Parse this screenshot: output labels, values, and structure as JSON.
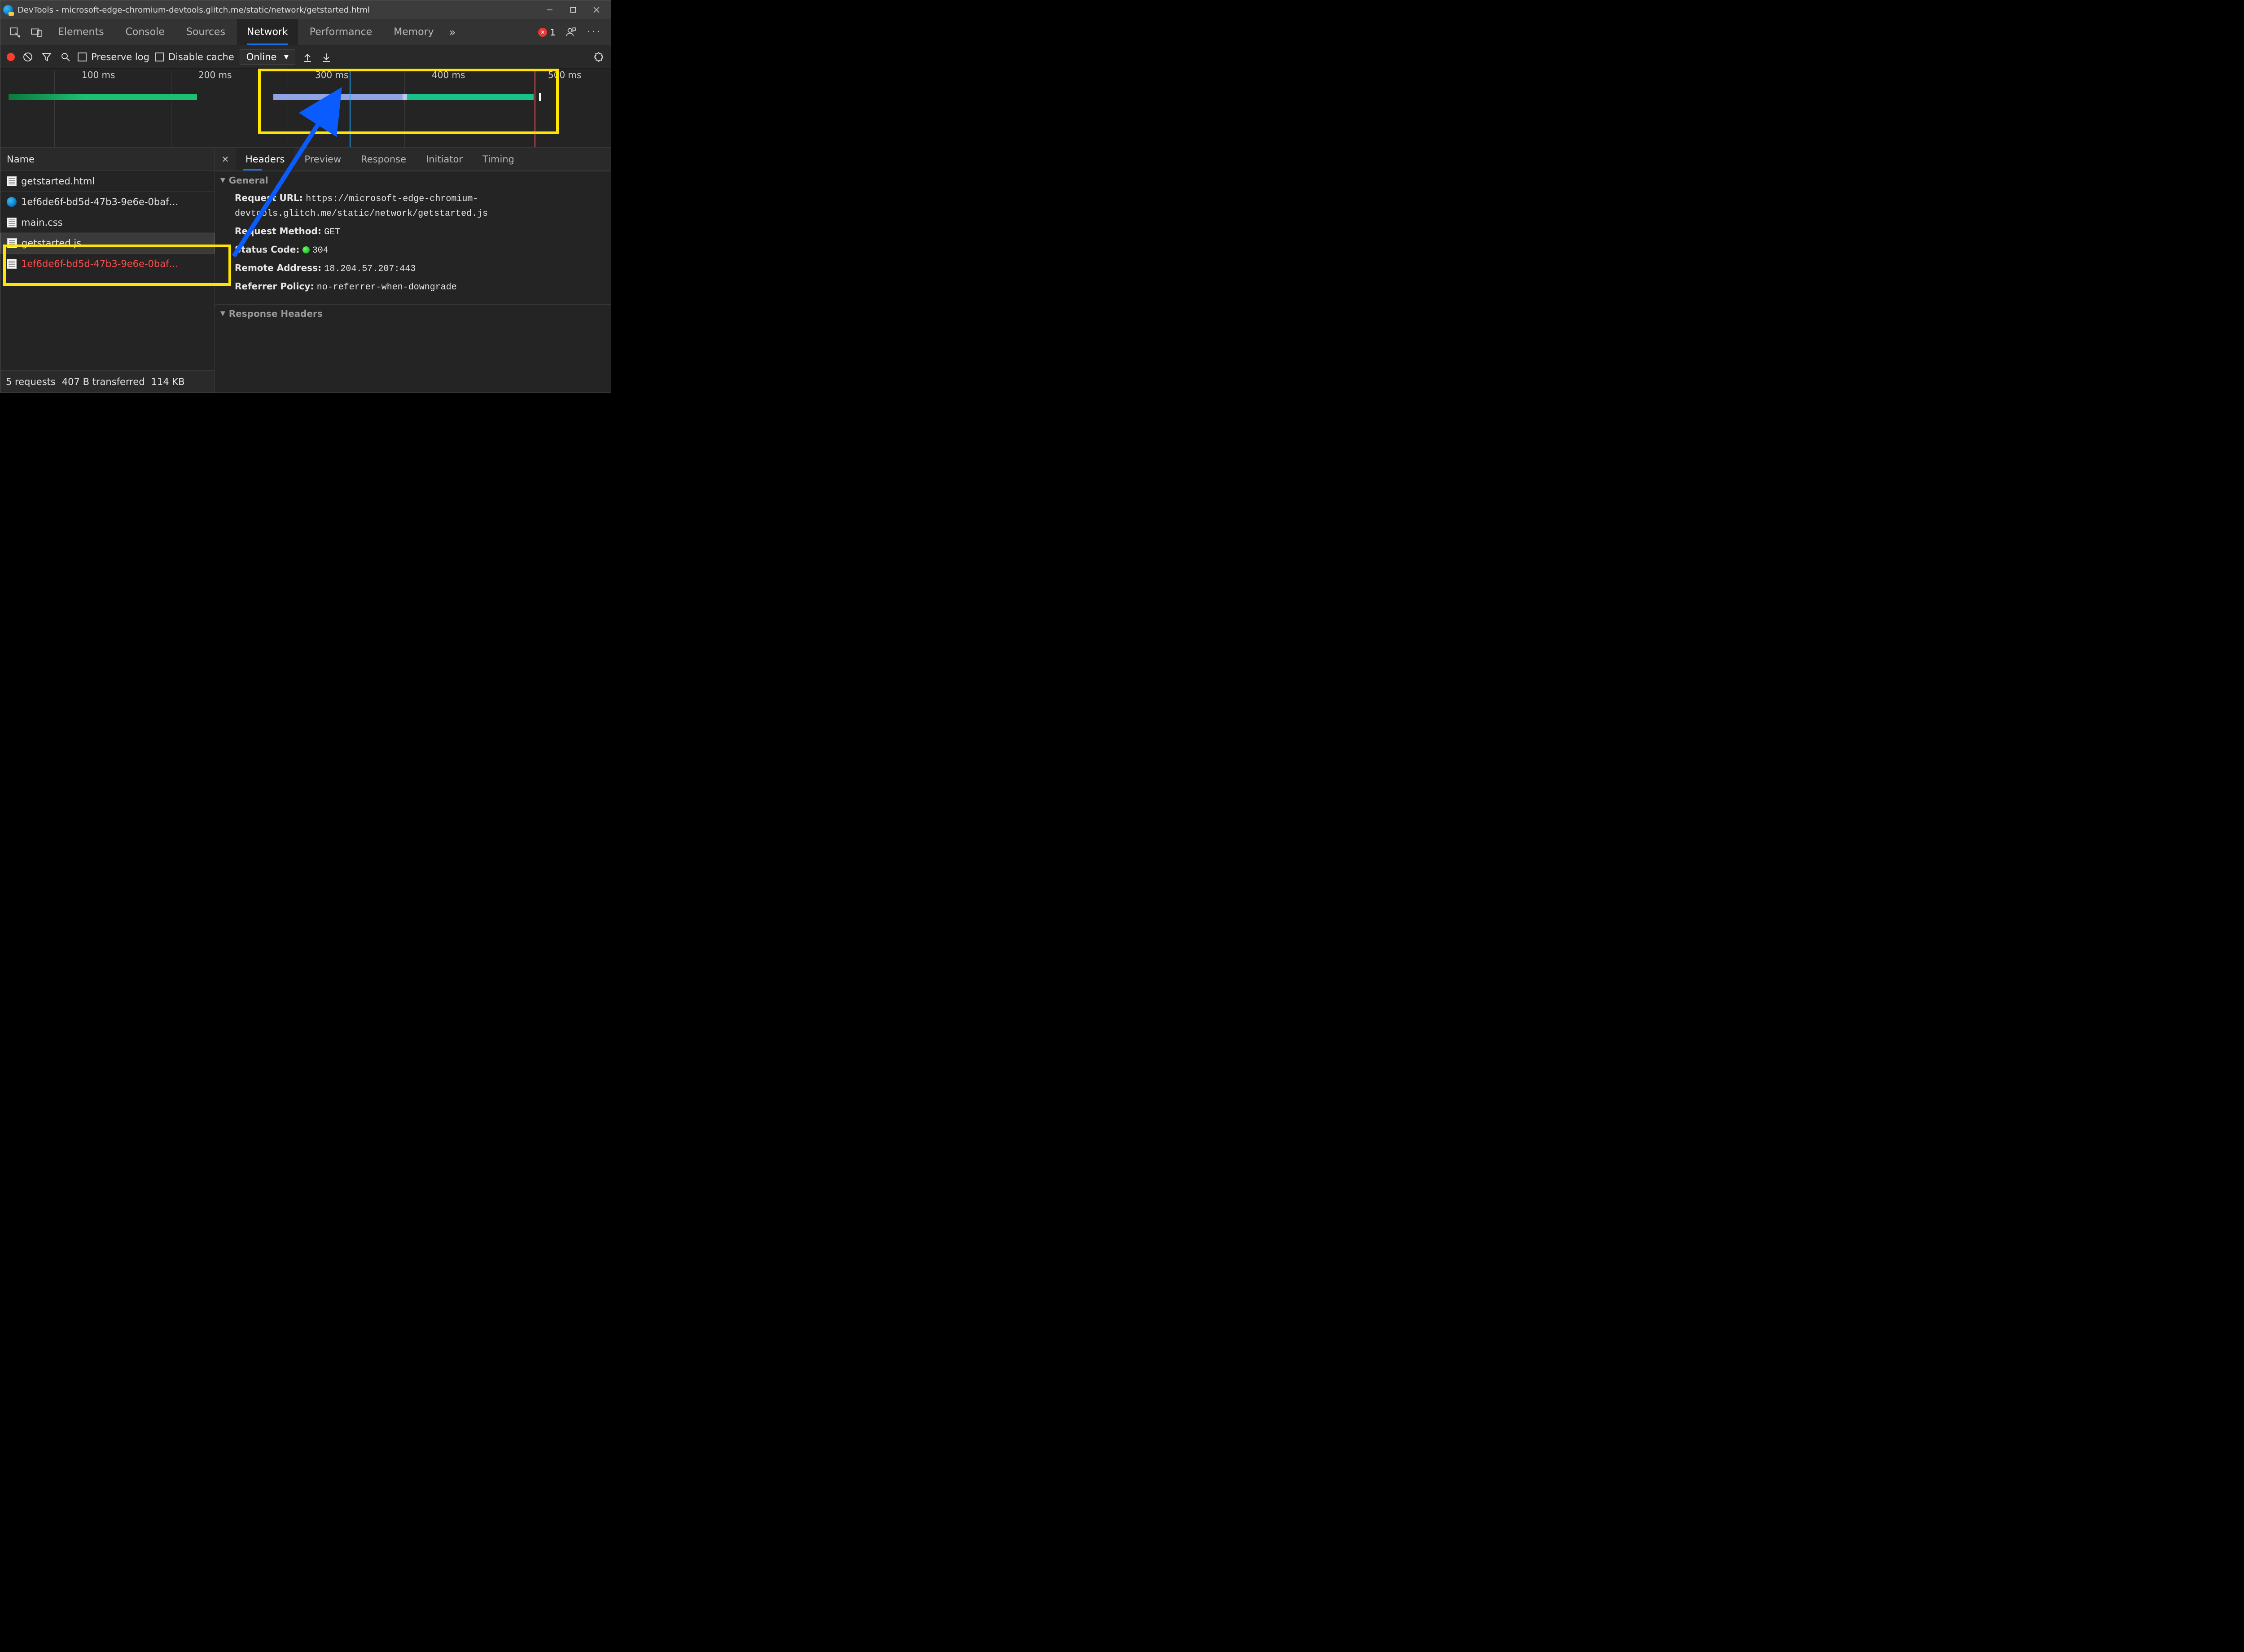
{
  "window": {
    "title": "DevTools - microsoft-edge-chromium-devtools.glitch.me/static/network/getstarted.html"
  },
  "tabs": {
    "items": [
      "Elements",
      "Console",
      "Sources",
      "Network",
      "Performance",
      "Memory"
    ],
    "active": "Network",
    "error_count": "1"
  },
  "toolbar": {
    "preserve_log": "Preserve log",
    "disable_cache": "Disable cache",
    "throttle": "Online"
  },
  "overview": {
    "ticks": [
      "100 ms",
      "200 ms",
      "300 ms",
      "400 ms",
      "500 ms"
    ]
  },
  "request_list": {
    "column": "Name",
    "items": [
      {
        "name": "getstarted.html",
        "icon": "doc",
        "state": ""
      },
      {
        "name": "1ef6de6f-bd5d-47b3-9e6e-0baf…",
        "icon": "edge",
        "state": ""
      },
      {
        "name": "main.css",
        "icon": "doc",
        "state": ""
      },
      {
        "name": "getstarted.js",
        "icon": "doc",
        "state": "selected"
      },
      {
        "name": "1ef6de6f-bd5d-47b3-9e6e-0baf…",
        "icon": "doc",
        "state": "error"
      }
    ]
  },
  "status": {
    "requests": "5 requests",
    "transferred": "407 B transferred",
    "resources": "114 KB"
  },
  "detail": {
    "tabs": [
      "Headers",
      "Preview",
      "Response",
      "Initiator",
      "Timing"
    ],
    "active": "Headers",
    "sections": {
      "general": "General",
      "response_headers": "Response Headers"
    },
    "general": {
      "request_url_k": "Request URL:",
      "request_url_v": "https://microsoft-edge-chromium-devtools.glitch.me/static/network/getstarted.js",
      "request_method_k": "Request Method:",
      "request_method_v": "GET",
      "status_code_k": "Status Code:",
      "status_code_v": "304",
      "remote_address_k": "Remote Address:",
      "remote_address_v": "18.204.57.207:443",
      "referrer_policy_k": "Referrer Policy:",
      "referrer_policy_v": "no-referrer-when-downgrade"
    }
  }
}
